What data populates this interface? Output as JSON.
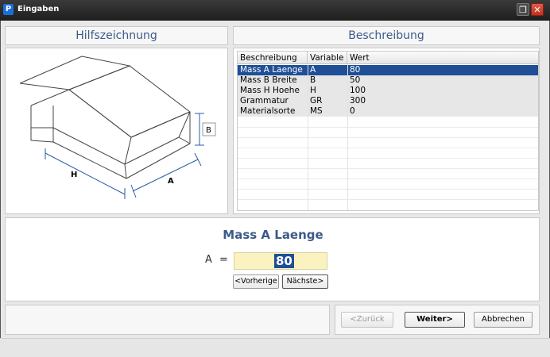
{
  "window": {
    "title": "Eingaben",
    "app_icon_letter": "P"
  },
  "headers": {
    "left": "Hilfszeichnung",
    "right": "Beschreibung"
  },
  "drawing_labels": {
    "h": "H",
    "a": "A",
    "b": "B"
  },
  "table": {
    "columns": [
      "Beschreibung",
      "Variable",
      "Wert"
    ],
    "rows": [
      {
        "beschreibung": "Mass A Laenge",
        "variable": "A",
        "wert": "80",
        "selected": true
      },
      {
        "beschreibung": "Mass B Breite",
        "variable": "B",
        "wert": "50",
        "selected": false
      },
      {
        "beschreibung": "Mass H Hoehe",
        "variable": "H",
        "wert": "100",
        "selected": false
      },
      {
        "beschreibung": "Grammatur",
        "variable": "GR",
        "wert": "300",
        "selected": false
      },
      {
        "beschreibung": "Materialsorte",
        "variable": "MS",
        "wert": "0",
        "selected": false
      }
    ]
  },
  "editor": {
    "title": "Mass A Laenge",
    "variable": "A",
    "equals": "=",
    "value": "80",
    "prev_label": "<Vorherige",
    "next_label": "Nächste>"
  },
  "footer": {
    "back_label": "<Zurück",
    "next_label": "Weiter>",
    "cancel_label": "Abbrechen"
  },
  "colors": {
    "accent_blue": "#1f4f96",
    "header_text": "#3c5a8a",
    "value_bg": "#fbf3bf"
  }
}
